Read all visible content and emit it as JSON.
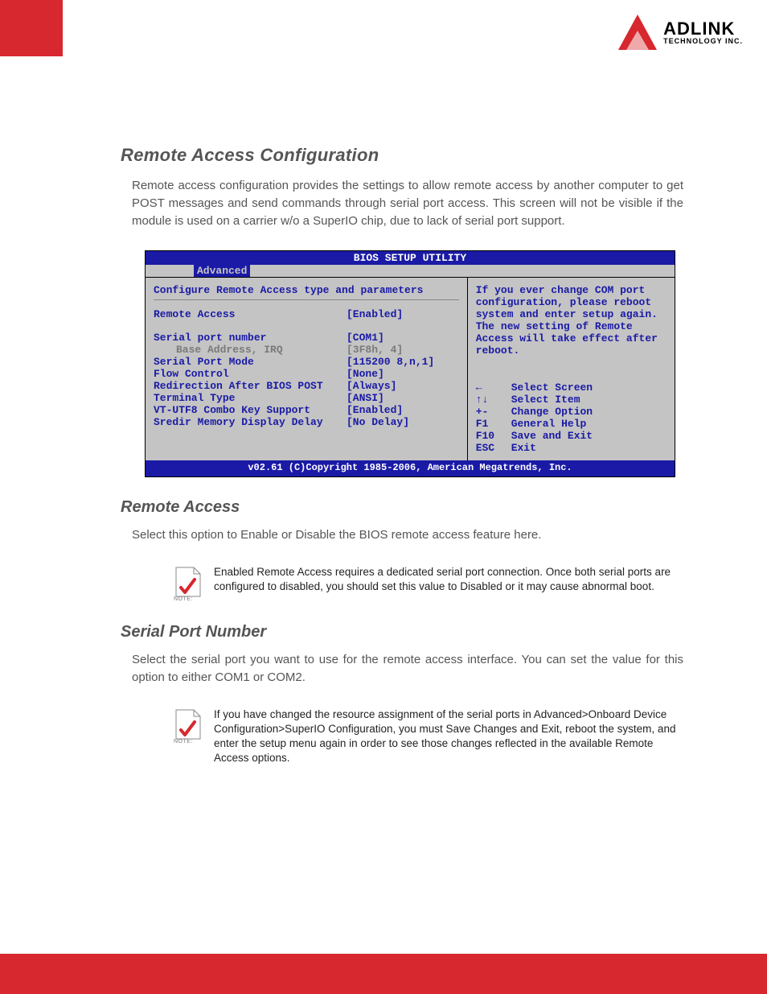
{
  "logo": {
    "main": "ADLINK",
    "sub": "TECHNOLOGY INC."
  },
  "section1": {
    "title": "Remote Access Configuration",
    "para": "Remote access configuration provides the settings to allow remote access by another computer to get POST messages and send commands through serial port access. This screen will not be visible if the module is used on a carrier w/o a SuperIO chip, due to lack of serial port support."
  },
  "bios": {
    "title": "BIOS SETUP UTILITY",
    "tab": "Advanced",
    "config_header": "Configure Remote Access type and parameters",
    "rows": [
      {
        "label": "Remote Access",
        "value": "[Enabled]",
        "grey": false,
        "blank_after": true
      },
      {
        "label": "Serial port number",
        "value": "[COM1]",
        "grey": false,
        "blank_after": false
      },
      {
        "label": "Base Address, IRQ",
        "value": "[3F8h, 4]",
        "grey": true,
        "blank_after": false
      },
      {
        "label": "Serial Port Mode",
        "value": "[115200 8,n,1]",
        "grey": false,
        "blank_after": false
      },
      {
        "label": "Flow Control",
        "value": "[None]",
        "grey": false,
        "blank_after": false
      },
      {
        "label": "Redirection After BIOS POST",
        "value": "[Always]",
        "grey": false,
        "blank_after": false
      },
      {
        "label": "Terminal Type",
        "value": "[ANSI]",
        "grey": false,
        "blank_after": false
      },
      {
        "label": "VT-UTF8 Combo Key Support",
        "value": "[Enabled]",
        "grey": false,
        "blank_after": false
      },
      {
        "label": "Sredir Memory Display Delay",
        "value": "[No Delay]",
        "grey": false,
        "blank_after": false
      }
    ],
    "help": "If you ever change COM port configuration, please reboot system and enter setup again. The new setting of Remote Access will take effect after reboot.",
    "nav": [
      {
        "key": "←",
        "action": "Select Screen"
      },
      {
        "key": "↑↓",
        "action": "Select Item"
      },
      {
        "key": "+-",
        "action": "Change Option"
      },
      {
        "key": "F1",
        "action": "General Help"
      },
      {
        "key": "F10",
        "action": "Save and Exit"
      },
      {
        "key": "ESC",
        "action": "Exit"
      }
    ],
    "footer": "v02.61 (C)Copyright 1985-2006, American Megatrends, Inc."
  },
  "section2": {
    "title": "Remote Access",
    "para": "Select this option to Enable or Disable the BIOS remote access feature here.",
    "note": "Enabled Remote Access requires a dedicated serial port connection. Once both serial ports are configured to disabled, you should set this value to Disabled or it may cause abnormal boot."
  },
  "section3": {
    "title": "Serial Port Number",
    "para": "Select the serial port you want to use for the remote access interface. You can set the value for this option to either COM1 or COM2.",
    "note": "If you have changed the resource assignment of the serial ports in Advanced>Onboard Device Configuration>SuperIO Configuration, you must Save Changes and Exit, reboot the system, and enter the setup menu again in order to see those changes reflected in the available Remote Access options."
  },
  "note_label": "NOTE:"
}
